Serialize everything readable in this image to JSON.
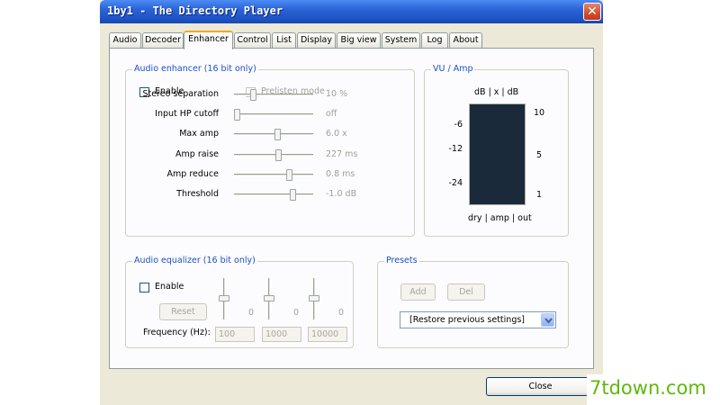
{
  "window": {
    "title": "1by1 - The Directory Player",
    "close_glyph": "✕"
  },
  "tabs": [
    {
      "label": "Audio"
    },
    {
      "label": "Decoder"
    },
    {
      "label": "Enhancer"
    },
    {
      "label": "Control"
    },
    {
      "label": "List"
    },
    {
      "label": "Display"
    },
    {
      "label": "Big view"
    },
    {
      "label": "System"
    },
    {
      "label": "Log"
    },
    {
      "label": "About"
    }
  ],
  "active_tab": "Enhancer",
  "enhancer": {
    "legend": "Audio enhancer (16 bit only)",
    "enable_label": "Enable",
    "enable_checked": false,
    "prelisten_label": "Prelisten mode",
    "prelisten_checked": false,
    "sliders": [
      {
        "label": "Stereo separation",
        "value": "10 %",
        "position": 0.22
      },
      {
        "label": "Input HP cutoff",
        "value": "off",
        "position": 0.0
      },
      {
        "label": "Max amp",
        "value": "6.0 x",
        "position": 0.56
      },
      {
        "label": "Amp raise",
        "value": "227 ms",
        "position": 0.58
      },
      {
        "label": "Amp reduce",
        "value": "0.8 ms",
        "position": 0.73
      },
      {
        "label": "Threshold",
        "value": "-1.0 dB",
        "position": 0.77
      }
    ]
  },
  "vu": {
    "legend": "VU / Amp",
    "header": "dB | x | dB",
    "left_scale": [
      "-6",
      "-12",
      "-24"
    ],
    "right_scale": [
      "10",
      "5",
      "1"
    ],
    "footer": "dry | amp | out"
  },
  "equalizer": {
    "legend": "Audio equalizer (16 bit only)",
    "enable_label": "Enable",
    "enable_checked": false,
    "reset_label": "Reset",
    "frequency_label": "Frequency (Hz):",
    "bands": [
      {
        "value": "0",
        "frequency": "100",
        "position": 0.5
      },
      {
        "value": "0",
        "frequency": "1000",
        "position": 0.5
      },
      {
        "value": "0",
        "frequency": "10000",
        "position": 0.5
      }
    ]
  },
  "presets": {
    "legend": "Presets",
    "add_label": "Add",
    "del_label": "Del",
    "selected": "[Restore previous settings]"
  },
  "footer": {
    "close_label": "Close"
  },
  "watermark": {
    "text": "7tdown.com"
  },
  "colors": {
    "titlebar": "#2c63d6",
    "legend": "#1f4fc4",
    "vu_meter": "#1a2a3a",
    "watermark": "#5fb80c"
  }
}
